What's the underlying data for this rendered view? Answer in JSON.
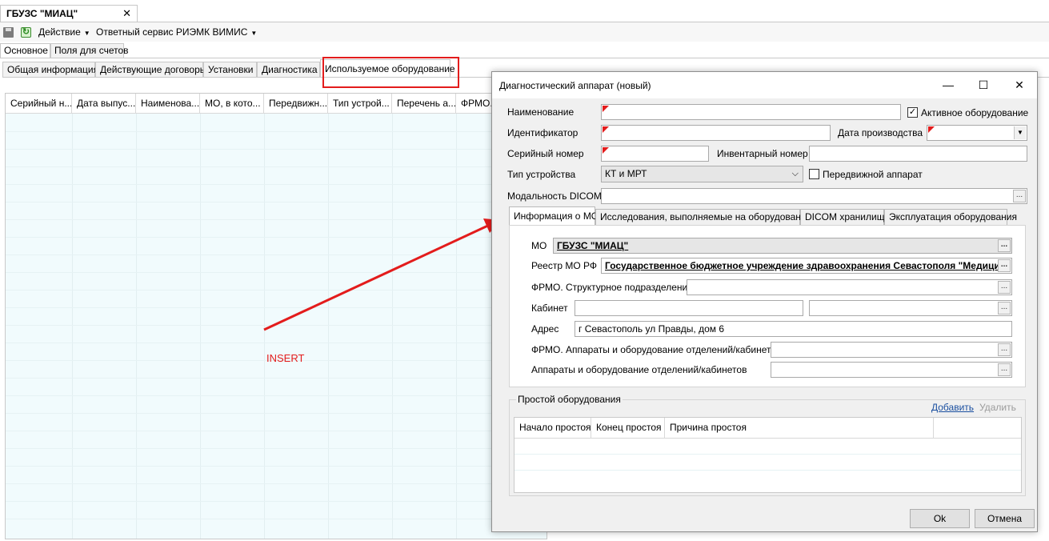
{
  "window": {
    "doc_tab_title": "ГБУЗС \"МИАЦ\"",
    "doc_tab_close": "✕"
  },
  "toolbar": {
    "save_icon": "save-icon",
    "refresh_icon": "refresh-icon",
    "menu_action": "Действие",
    "menu_service": "Ответный сервис РИЭМК ВИМИС"
  },
  "sub_tabs": [
    "Основное",
    "Поля для счетов"
  ],
  "info_tabs": [
    "Общая информация",
    "Действующие договоры",
    "Установки",
    "Диагностика",
    "Используемое оборудование"
  ],
  "grid": {
    "columns": [
      "Серийный н...",
      "Дата выпус...",
      "Наименова...",
      "МО, в кото...",
      "Передвижн...",
      "Тип устрой...",
      "Перечень а...",
      "ФРМО."
    ]
  },
  "annotation": {
    "insert_label": "INSERT",
    "highlight_color": "#e31c1c"
  },
  "dialog": {
    "title": "Диагностический аппарат (новый)",
    "minimize": "—",
    "maximize": "☐",
    "close": "✕",
    "fields": {
      "name_label": "Наименование",
      "name_value": "",
      "active_label": "Активное оборудование",
      "active_checked": true,
      "identifier_label": "Идентификатор",
      "identifier_value": "",
      "prod_date_label": "Дата производства",
      "prod_date_value": "",
      "serial_label": "Серийный номер",
      "serial_value": "",
      "inventory_label": "Инвентарный номер",
      "inventory_value": "",
      "device_type_label": "Тип устройства",
      "device_type_value": "КТ и МРТ",
      "mobile_label": "Передвижной аппарат",
      "mobile_checked": false,
      "modality_label": "Модальность DICOM",
      "modality_value": ""
    },
    "inner_tabs": [
      "Информация о МО",
      "Исследования, выполняемые на оборудовании",
      "DICOM хранилища",
      "Эксплуатация оборудования"
    ],
    "mo_info": {
      "mo_label": "МО",
      "mo_value": "ГБУЗС \"МИАЦ\"",
      "registry_label": "Реестр МО РФ",
      "registry_value": "Государственное бюджетное учреждение здравоохранения Севастополя \"Медицин",
      "frmo_sub_label": "ФРМО. Структурное подразделение",
      "frmo_sub_value": "",
      "cabinet_label": "Кабинет",
      "cabinet_value1": "",
      "cabinet_value2": "",
      "address_label": "Адрес",
      "address_value": "г Севастополь  ул Правды, дом 6",
      "frmo_equip_label": "ФРМО. Аппараты и оборудование отделений/кабинетов",
      "frmo_equip_value": "",
      "equip_label": "Аппараты  и  оборудование  отделений/кабинетов",
      "equip_value": ""
    },
    "downtime": {
      "title": "Простой оборудования",
      "add": "Добавить",
      "delete": "Удалить",
      "columns": [
        "Начало простоя",
        "Конец простоя",
        "Причина простоя"
      ]
    },
    "ok": "Ok",
    "cancel": "Отмена",
    "ellipsis": "..."
  }
}
